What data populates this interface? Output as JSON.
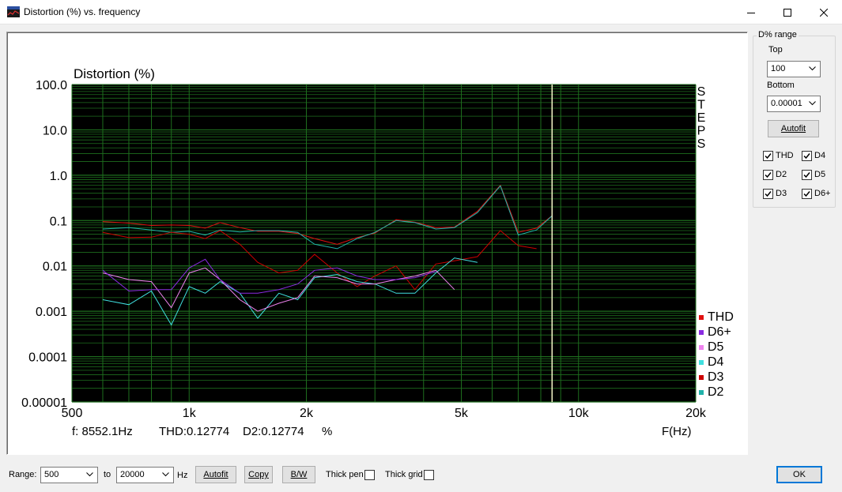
{
  "window": {
    "title": "Distortion (%) vs. frequency",
    "app_icon": "scope-app-icon",
    "controls": [
      "minimize-icon",
      "maximize-icon",
      "close-icon"
    ]
  },
  "chart_data": {
    "type": "line",
    "title": "Distortion (%)",
    "xlabel": "F(Hz)",
    "x_scale": "log",
    "y_scale": "log",
    "xlim": [
      500,
      20000
    ],
    "ylim": [
      1e-05,
      100
    ],
    "x_tick_labels": [
      "500",
      "1k",
      "2k",
      "5k",
      "10k",
      "20k"
    ],
    "x_tick_values": [
      500,
      1000,
      2000,
      5000,
      10000,
      20000
    ],
    "y_tick_labels": [
      "100.0",
      "10.0",
      "1.0",
      "0.1",
      "0.01",
      "0.001",
      "0.0001",
      "0.00001"
    ],
    "y_tick_values": [
      100,
      10,
      1,
      0.1,
      0.01,
      0.001,
      0.0001,
      1e-05
    ],
    "grid": true,
    "background": "#000000",
    "grid_color": "#1e6e1e",
    "side_label": [
      "S",
      "T",
      "E",
      "P",
      "S"
    ],
    "cursor": {
      "freq": 8552.1,
      "color": "#f5f5c8"
    },
    "readout": {
      "freq": "f: 8552.1Hz",
      "thd": "THD:0.12774",
      "d2": "D2:0.12774",
      "unit": "%"
    },
    "legend_position": "right-bottom",
    "legend": [
      {
        "name": "THD",
        "color": "#e01010"
      },
      {
        "name": "D6+",
        "color": "#8a2be2"
      },
      {
        "name": "D5",
        "color": "#ee82ee"
      },
      {
        "name": "D4",
        "color": "#40e0e0"
      },
      {
        "name": "D3",
        "color": "#cc0000"
      },
      {
        "name": "D2",
        "color": "#20b2aa"
      }
    ],
    "series": [
      {
        "name": "THD",
        "color": "#e01010",
        "x": [
          600,
          700,
          800,
          900,
          1000,
          1100,
          1200,
          1350,
          1500,
          1700,
          1900,
          2100,
          2400,
          2700,
          3000,
          3400,
          3800,
          4300,
          4800,
          5500,
          6300,
          7000,
          7800,
          8552
        ],
        "y": [
          0.095,
          0.088,
          0.078,
          0.08,
          0.078,
          0.068,
          0.09,
          0.07,
          0.058,
          0.058,
          0.052,
          0.04,
          0.03,
          0.042,
          0.053,
          0.105,
          0.092,
          0.07,
          0.072,
          0.16,
          0.6,
          0.055,
          0.068,
          0.1277
        ]
      },
      {
        "name": "D2",
        "color": "#20b2aa",
        "x": [
          600,
          700,
          800,
          900,
          1000,
          1100,
          1200,
          1350,
          1500,
          1700,
          1900,
          2100,
          2400,
          2700,
          3000,
          3400,
          3800,
          4300,
          4800,
          5500,
          6300,
          7000,
          7800,
          8552
        ],
        "y": [
          0.065,
          0.07,
          0.062,
          0.055,
          0.058,
          0.048,
          0.062,
          0.056,
          0.06,
          0.06,
          0.055,
          0.03,
          0.024,
          0.04,
          0.055,
          0.1,
          0.09,
          0.065,
          0.07,
          0.15,
          0.58,
          0.048,
          0.062,
          0.1277
        ]
      },
      {
        "name": "D3",
        "color": "#cc0000",
        "x": [
          600,
          700,
          800,
          900,
          1000,
          1100,
          1200,
          1350,
          1500,
          1700,
          1900,
          2100,
          2400,
          2700,
          3000,
          3400,
          3800,
          4300,
          4800,
          5500,
          6300,
          7000,
          7800
        ],
        "y": [
          0.055,
          0.042,
          0.043,
          0.055,
          0.05,
          0.04,
          0.06,
          0.03,
          0.012,
          0.007,
          0.008,
          0.018,
          0.007,
          0.0035,
          0.006,
          0.01,
          0.003,
          0.011,
          0.013,
          0.016,
          0.06,
          0.028,
          0.024
        ]
      },
      {
        "name": "D4",
        "color": "#40e0e0",
        "x": [
          600,
          700,
          800,
          900,
          1000,
          1100,
          1200,
          1350,
          1500,
          1700,
          1900,
          2100,
          2400,
          2700,
          3000,
          3400,
          3800,
          4300,
          4800,
          5500
        ],
        "y": [
          0.0018,
          0.0014,
          0.0028,
          0.0005,
          0.0035,
          0.0025,
          0.0045,
          0.0025,
          0.0007,
          0.0025,
          0.0018,
          0.0055,
          0.0065,
          0.0045,
          0.004,
          0.0025,
          0.0025,
          0.007,
          0.015,
          0.012
        ]
      },
      {
        "name": "D5",
        "color": "#ee82ee",
        "x": [
          600,
          700,
          800,
          900,
          1000,
          1100,
          1200,
          1350,
          1500,
          1700,
          1900,
          2100,
          2400,
          2700,
          3000,
          3400,
          3800,
          4300,
          4800
        ],
        "y": [
          0.007,
          0.005,
          0.0045,
          0.0012,
          0.007,
          0.009,
          0.005,
          0.0018,
          0.001,
          0.0015,
          0.002,
          0.006,
          0.0055,
          0.004,
          0.004,
          0.005,
          0.006,
          0.008,
          0.003
        ]
      },
      {
        "name": "D6+",
        "color": "#8a2be2",
        "x": [
          600,
          700,
          800,
          900,
          1000,
          1100,
          1200,
          1350,
          1500,
          1700,
          1900,
          2100,
          2400,
          2700,
          3000,
          3400,
          3800,
          4300
        ],
        "y": [
          0.008,
          0.0028,
          0.003,
          0.003,
          0.009,
          0.014,
          0.005,
          0.0025,
          0.0025,
          0.003,
          0.004,
          0.008,
          0.009,
          0.006,
          0.005,
          0.005,
          0.0055,
          0.0075
        ]
      }
    ]
  },
  "side_panel": {
    "group_title": "D% range",
    "top_label": "Top",
    "top_value": "100",
    "bottom_label": "Bottom",
    "bottom_value": "0.00001",
    "autofit_label": "Autofit",
    "checkboxes": [
      {
        "label": "THD",
        "checked": true
      },
      {
        "label": "D4",
        "checked": true
      },
      {
        "label": "D2",
        "checked": true
      },
      {
        "label": "D5",
        "checked": true
      },
      {
        "label": "D3",
        "checked": true
      },
      {
        "label": "D6+",
        "checked": true
      }
    ]
  },
  "bottom_bar": {
    "range_label": "Range:",
    "from_value": "500",
    "to_label": "to",
    "to_value": "20000",
    "unit_label": "Hz",
    "autofit_label": "Autofit",
    "copy_label": "Copy",
    "bw_label": "B/W",
    "thick_pen_label": "Thick pen",
    "thick_pen_checked": false,
    "thick_grid_label": "Thick grid",
    "thick_grid_checked": false,
    "ok_label": "OK"
  }
}
